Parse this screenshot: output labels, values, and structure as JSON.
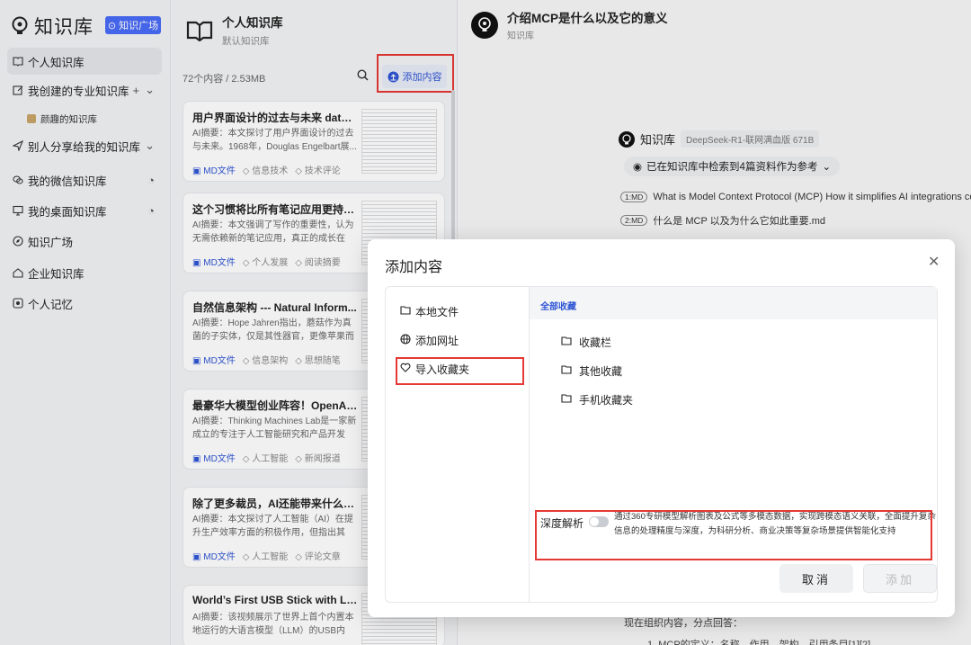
{
  "sidebar": {
    "app_name": "知识库",
    "plaza_button": "知识广场",
    "items": [
      {
        "label": "个人知识库"
      },
      {
        "label": "我创建的专业知识库"
      },
      {
        "label": "别人分享给我的知识库"
      },
      {
        "label": "我的微信知识库"
      },
      {
        "label": "我的桌面知识库"
      },
      {
        "label": "知识广场"
      },
      {
        "label": "企业知识库"
      },
      {
        "label": "个人记忆"
      }
    ],
    "sub_item": "颜趣的知识库"
  },
  "kb": {
    "title": "个人知识库",
    "subtitle": "默认知识库",
    "count": "72个内容 / 2.53MB",
    "add_button": "添加内容",
    "cards": [
      {
        "title": "用户界面设计的过去与未来 datag...",
        "desc": "AI摘要：本文探讨了用户界面设计的过去与未来。1968年，Douglas Engelbart展...",
        "tags": [
          "MD文件",
          "信息技术",
          "技术评论"
        ]
      },
      {
        "title": "这个习惯将比所有笔记应用更持久...",
        "desc": "AI摘要：本文强调了写作的重要性，认为无需依赖新的笔记应用，真正的成长在于...",
        "tags": [
          "MD文件",
          "个人发展",
          "阅读摘要"
        ]
      },
      {
        "title": "自然信息架构 --- Natural Inform...",
        "desc": "AI摘要：Hope Jahren指出，蘑菇作为真菌的子实体，仅是其性器官，更像苹果而非...",
        "tags": [
          "MD文件",
          "信息架构",
          "思想随笔"
        ]
      },
      {
        "title": "最豪华大模型创业阵容！OpenAI...",
        "desc": "AI摘要：Thinking Machines Lab是一家新成立的专注于人工智能研究和产品开发的...",
        "tags": [
          "MD文件",
          "人工智能",
          "新闻报道"
        ]
      },
      {
        "title": "除了更多裁员，AI还能带来什么？...",
        "desc": "AI摘要：本文探讨了人工智能（AI）在提升生产效率方面的积极作用，但指出其未...",
        "tags": [
          "MD文件",
          "人工智能",
          "评论文章"
        ]
      },
      {
        "title": "World’s First USB Stick with Loc...",
        "desc": "AI摘要：该视频展示了世界上首个内置本地运行的大语言模型（LLM）的USB内存...",
        "tags": []
      }
    ]
  },
  "chat": {
    "title": "介绍MCP是什么以及它的意义",
    "subtitle": "知识库",
    "assistant_name": "知识库",
    "model": "DeepSeek-R1-联网满血版 671B",
    "detect_text": "已在知识库中检索到4篇资料作为参考",
    "refs": [
      {
        "badge": "1:MD",
        "text": "What is Model Context Protocol (MCP) How it simplifies AI integrations com"
      },
      {
        "badge": "2:MD",
        "text": "什么是 MCP 以及为什么它如此重要.md"
      }
    ],
    "bottom_text_1": "现在组织内容，分点回答：",
    "bottom_text_2": "1. MCP的定义：名称、作用、架构，引用条目[1][2]。"
  },
  "modal": {
    "title": "添加内容",
    "options": [
      {
        "label": "本地文件"
      },
      {
        "label": "添加网址"
      },
      {
        "label": "导入收藏夹"
      }
    ],
    "header": "全部收藏",
    "folders": [
      {
        "label": "收藏栏"
      },
      {
        "label": "其他收藏"
      },
      {
        "label": "手机收藏夹"
      }
    ],
    "deep_label": "深度解析",
    "deep_desc": "通过360专研模型解析图表及公式等多模态数据，实现跨模态语义关联，全面提升复杂信息的处理精度与深度，为科研分析、商业决策等复杂场景提供智能化支持",
    "cancel": "取消",
    "add": "添加"
  },
  "colors": {
    "accent": "#2f55d4",
    "highlight_box": "#e53935"
  }
}
